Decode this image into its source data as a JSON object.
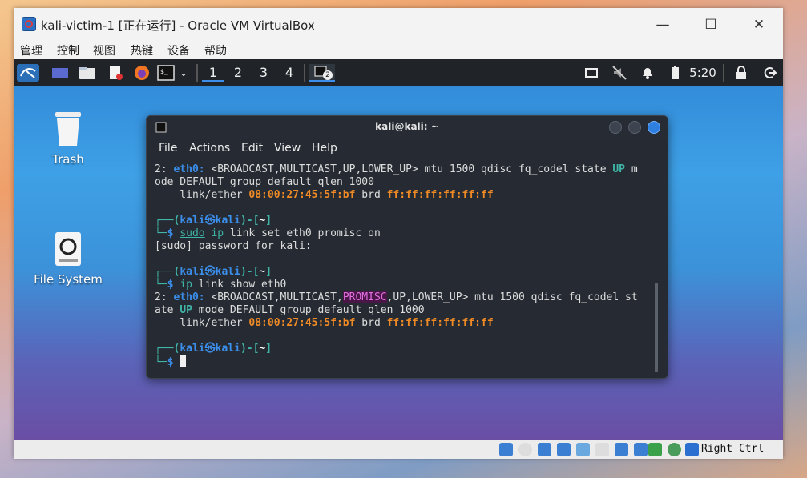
{
  "window": {
    "title": "kali-victim-1 [正在运行] - Oracle VM VirtualBox",
    "controls": {
      "minimize": "—",
      "maximize": "☐",
      "close": "✕"
    }
  },
  "menubar": [
    "管理",
    "控制",
    "视图",
    "热键",
    "设备",
    "帮助"
  ],
  "panel": {
    "workspaces": [
      "1",
      "2",
      "3",
      "4"
    ],
    "active_workspace": "1",
    "task_badge": "2",
    "clock": "5:20"
  },
  "desktop": {
    "icons": [
      {
        "label": "Trash",
        "icon": "trash-icon"
      },
      {
        "label": "File System",
        "icon": "drive-icon"
      }
    ]
  },
  "terminal": {
    "title": "kali@kali: ~",
    "menu": [
      "File",
      "Actions",
      "Edit",
      "View",
      "Help"
    ],
    "lines": {
      "l1a": "2: ",
      "l1b": "eth0:",
      "l1c": " <BROADCAST,MULTICAST,UP,LOWER_UP> mtu 1500 qdisc fq_codel state ",
      "l1d": "UP",
      "l1e": " m",
      "l2": "ode DEFAULT group default qlen 1000",
      "l3a": "    link/ether ",
      "l3b": "08:00:27:45:5f:bf",
      "l3c": " brd ",
      "l3d": "ff:ff:ff:ff:ff:ff",
      "p1a": "┌──(",
      "p1b": "kali㉿kali",
      "p1c": ")-[",
      "p1d": "~",
      "p1e": "]",
      "c1a": "└─",
      "c1b": "$ ",
      "c1c": "sudo",
      "c1d": " ip",
      "c1e": " link set eth0 promisc on",
      "s1": "[sudo] password for kali:",
      "p2a": "┌──(",
      "p2b": "kali㉿kali",
      "p2c": ")-[",
      "p2d": "~",
      "p2e": "]",
      "c2a": "└─",
      "c2b": "$ ",
      "c2c": "ip",
      "c2d": " link show eth0",
      "r1a": "2: ",
      "r1b": "eth0:",
      "r1c": " <BROADCAST,MULTICAST,",
      "r1d": "PROMISC",
      "r1e": ",UP,LOWER_UP> mtu 1500 qdisc fq_codel st",
      "r2a": "ate ",
      "r2b": "UP",
      "r2c": " mode DEFAULT group default qlen 1000",
      "r3a": "    link/ether ",
      "r3b": "08:00:27:45:5f:bf",
      "r3c": " brd ",
      "r3d": "ff:ff:ff:ff:ff:ff",
      "p3a": "┌──(",
      "p3b": "kali㉿kali",
      "p3c": ")-[",
      "p3d": "~",
      "p3e": "]",
      "c3a": "└─",
      "c3b": "$ "
    }
  },
  "statusbar": {
    "host_key": "Right Ctrl"
  },
  "colors": {
    "accent_blue": "#3b8eea",
    "prompt_green": "#3fb6a8",
    "mac_orange": "#f08a25",
    "promisc_magenta": "#e36fe0"
  }
}
